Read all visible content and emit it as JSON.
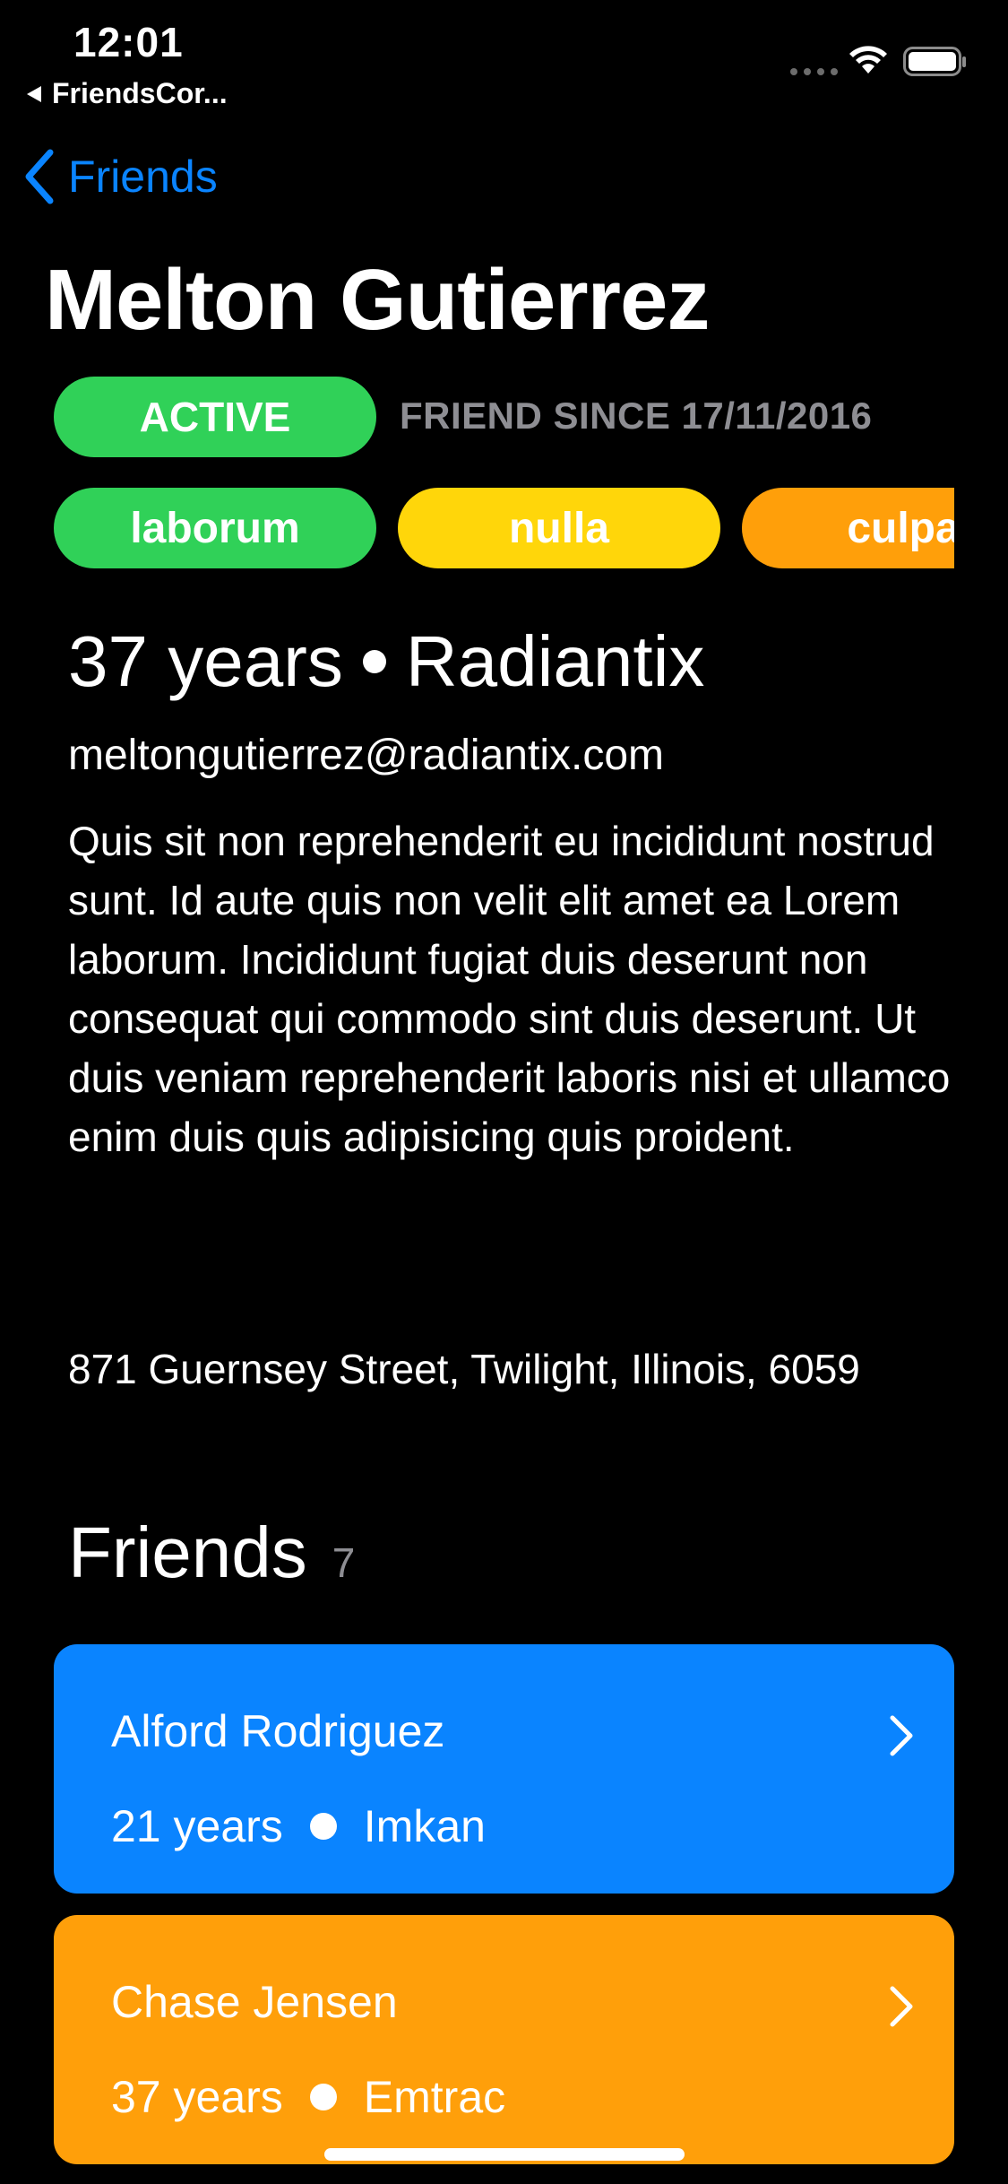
{
  "status_bar": {
    "time": "12:01",
    "back_app": "FriendsCor..."
  },
  "nav": {
    "back_label": "Friends"
  },
  "person": {
    "name": "Melton Gutierrez",
    "status": "ACTIVE",
    "friend_since": "FRIEND SINCE 17/11/2016",
    "tags": [
      {
        "label": "laborum",
        "color": "#30d158"
      },
      {
        "label": "nulla",
        "color": "#ffd60a"
      },
      {
        "label": "culpa",
        "color": "#ff9f0a"
      }
    ],
    "age": "37 years",
    "company": "Radiantix",
    "email": "meltongutierrez@radiantix.com",
    "about": "Quis sit non reprehenderit eu incididunt nostrud sunt. Id aute quis non velit elit amet ea Lorem laborum. Incididunt fugiat duis deserunt non consequat qui commodo sint duis deserunt. Ut duis veniam reprehenderit laboris nisi et ullamco enim duis quis adipisicing quis proident.",
    "address": "871 Guernsey Street, Twilight, Illinois, 6059"
  },
  "friends": {
    "heading": "Friends",
    "count": "7",
    "items": [
      {
        "name": "Alford Rodriguez",
        "age": "21 years",
        "company": "Imkan",
        "color": "#0a84ff"
      },
      {
        "name": "Chase Jensen",
        "age": "37 years",
        "company": "Emtrac",
        "color": "#ff9f0a"
      }
    ]
  },
  "colors": {
    "accent": "#0a84ff",
    "active": "#30d158",
    "secondary_text": "#8e8e93"
  }
}
